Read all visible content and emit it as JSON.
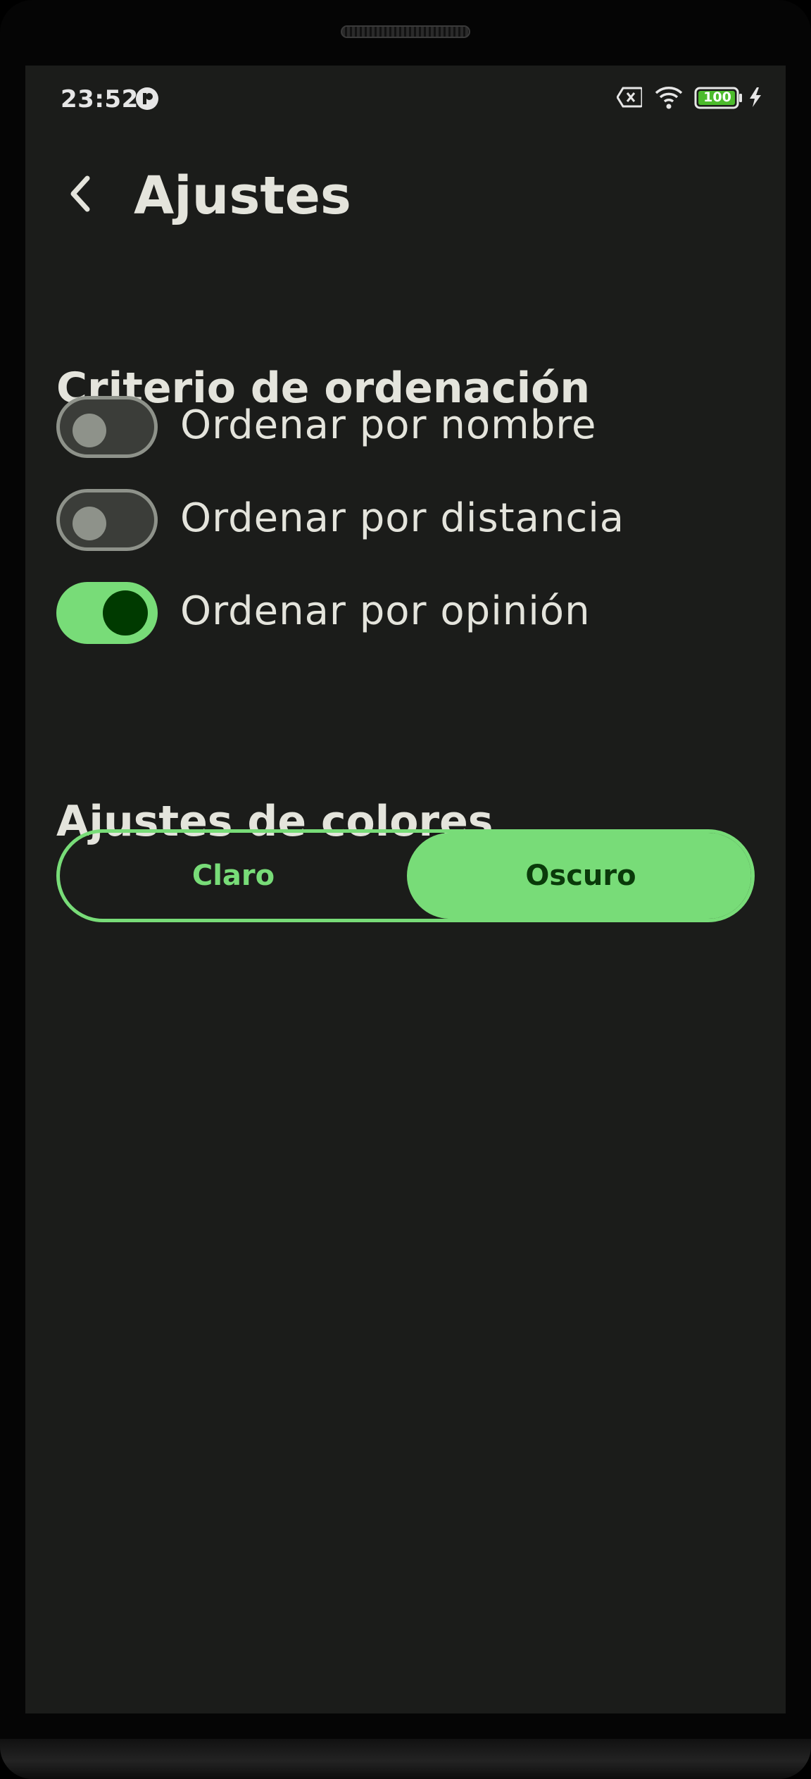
{
  "status_bar": {
    "time": "23:52",
    "battery_level": "100",
    "icons": [
      "notification-app-icon",
      "no-sim-icon",
      "wifi-icon",
      "battery-icon",
      "charging-bolt-icon"
    ]
  },
  "app_bar": {
    "title": "Ajustes",
    "back_icon": "chevron-left-icon"
  },
  "sort_section": {
    "title": "Criterio de ordenación",
    "options": [
      {
        "label": "Ordenar por nombre",
        "enabled": false
      },
      {
        "label": "Ordenar por distancia",
        "enabled": false
      },
      {
        "label": "Ordenar por opinión",
        "enabled": true
      }
    ]
  },
  "color_section": {
    "title": "Ajustes de colores",
    "options": [
      "Claro",
      "Oscuro"
    ],
    "selected": "Oscuro"
  },
  "colors": {
    "background": "#1b1c1a",
    "accent": "#78dc78",
    "accent_dark": "#003a00",
    "text": "#e4e4dc",
    "switch_off": "#8e928a"
  }
}
